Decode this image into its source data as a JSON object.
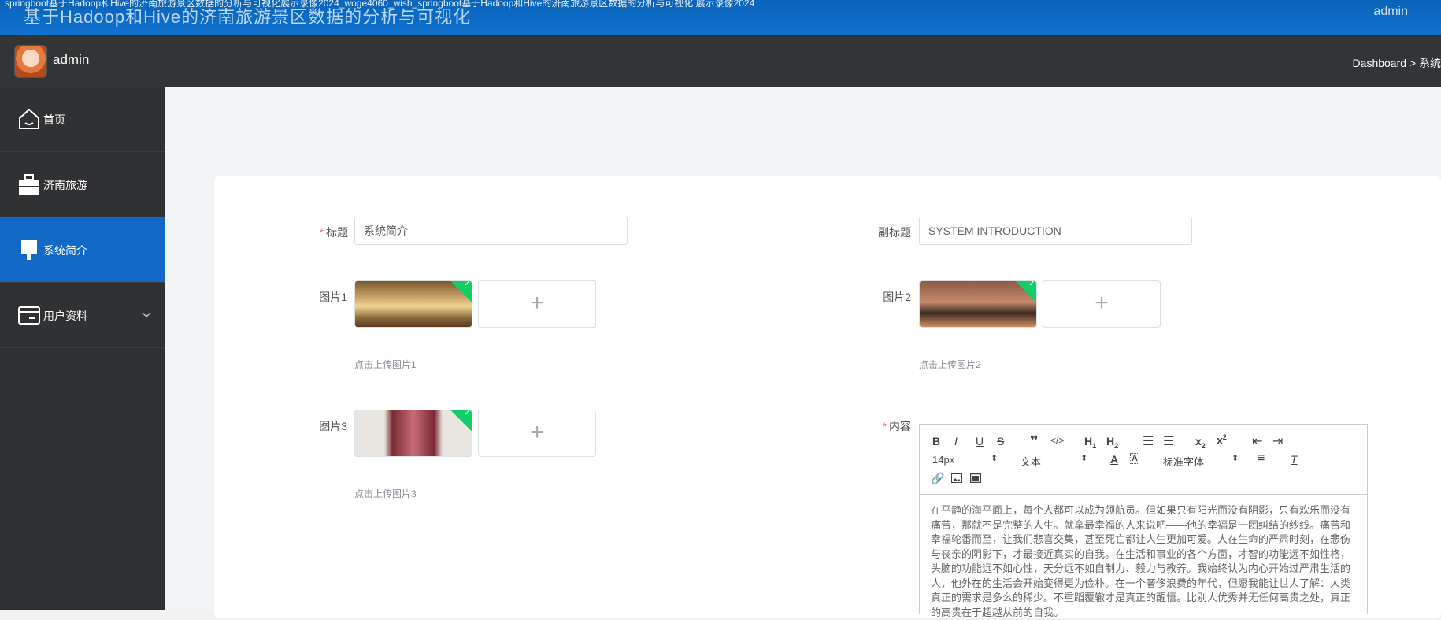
{
  "topbar": {
    "url_text": "springboot基于Hadoop和Hive的济南旅游景区数据的分析与可视化展示录像2024_woge4060_wish_springboot基于Hadoop和Hive的济南旅游景区数据的分析与可视化 展示录像2024",
    "title": "基于Hadoop和Hive的济南旅游景区数据的分析与可视化",
    "user": "admin"
  },
  "header": {
    "username": "admin",
    "breadcrumb": "Dashboard > 系统"
  },
  "sidebar": {
    "items": [
      {
        "label": "首页",
        "icon": "home-icon"
      },
      {
        "label": "济南旅游",
        "icon": "briefcase-icon"
      },
      {
        "label": "系统简介",
        "icon": "brush-icon"
      },
      {
        "label": "用户资料",
        "icon": "card-icon",
        "chevron": "⌄"
      }
    ]
  },
  "form": {
    "title_label": "标题",
    "title_value": "系统简介",
    "subtitle_label": "副标题",
    "subtitle_value": "SYSTEM INTRODUCTION",
    "image1_label": "图片1",
    "image1_hint": "点击上传图片1",
    "image2_label": "图片2",
    "image2_hint": "点击上传图片2",
    "image3_label": "图片3",
    "image3_hint": "点击上传图片3",
    "content_label": "内容",
    "plus": "+"
  },
  "editor": {
    "font_size": "14px",
    "text_style": "文本",
    "font_family": "标准字体",
    "content": "在平静的海平面上，每个人都可以成为领航员。但如果只有阳光而没有阴影，只有欢乐而没有痛苦，那就不是完整的人生。就拿最幸福的人来说吧——他的幸福是一团纠结的纱线。痛苦和幸福轮番而至，让我们悲喜交集，甚至死亡都让人生更加可爱。人在生命的严肃时刻，在悲伤与丧亲的阴影下，才最接近真实的自我。在生活和事业的各个方面，才智的功能远不如性格，头脑的功能远不如心性，天分远不如自制力、毅力与教养。我始终认为内心开始过严肃生活的人，他外在的生活会开始变得更为俭朴。在一个奢侈浪费的年代，但愿我能让世人了解：人类真正的需求是多么的稀少。不重蹈覆辙才是真正的醒悟。比别人优秀并无任何高贵之处，真正的高贵在于超越从前的自我。"
  },
  "colors": {
    "topbar": "#1172cf",
    "header": "#333436",
    "sidebar": "#303133",
    "active": "#1168c6",
    "upload_ok": "#13ce66",
    "required": "#f56c6c"
  }
}
